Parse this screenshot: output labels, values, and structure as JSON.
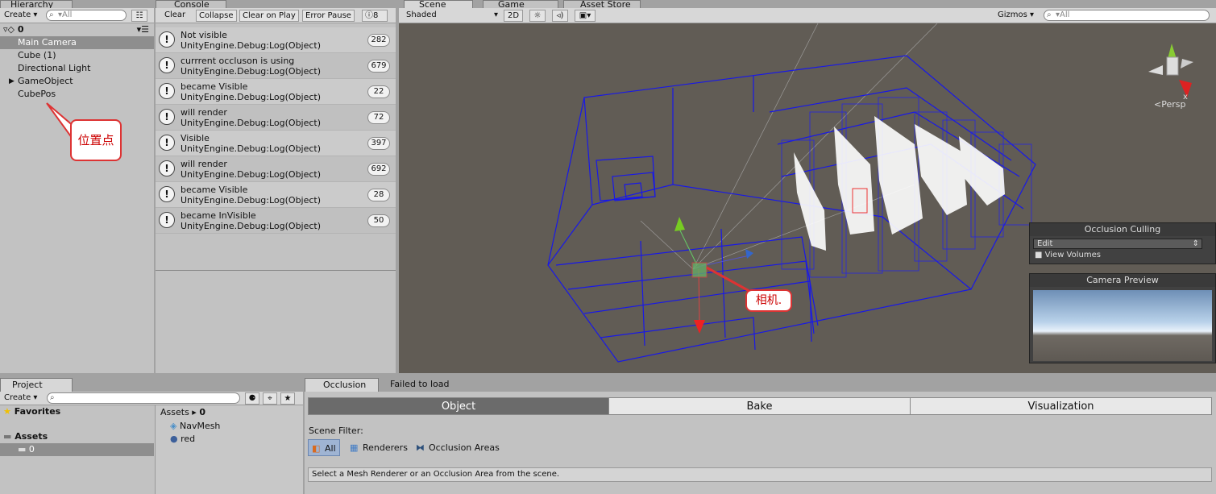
{
  "hierarchy": {
    "tab": "Hierarchy",
    "create": "Create ▾",
    "search_placeholder": "▾All",
    "scene_name": "0",
    "items": [
      "Main Camera",
      "Cube (1)",
      "Directional Light",
      "GameObject",
      "CubePos"
    ],
    "callout": "位置点"
  },
  "console": {
    "tab": "Console",
    "buttons": [
      "Clear",
      "Collapse",
      "Clear on Play",
      "Error Pause"
    ],
    "warn_count": "8",
    "entries": [
      {
        "line1": "Not visible",
        "line2": "UnityEngine.Debug:Log(Object)",
        "count": "282"
      },
      {
        "line1": "currrent occluson is using",
        "line2": "UnityEngine.Debug:Log(Object)",
        "count": "679"
      },
      {
        "line1": "became Visible",
        "line2": "UnityEngine.Debug:Log(Object)",
        "count": "22"
      },
      {
        "line1": "will render",
        "line2": "UnityEngine.Debug:Log(Object)",
        "count": "72"
      },
      {
        "line1": "Visible",
        "line2": "UnityEngine.Debug:Log(Object)",
        "count": "397"
      },
      {
        "line1": "will render",
        "line2": "UnityEngine.Debug:Log(Object)",
        "count": "692"
      },
      {
        "line1": "became Visible",
        "line2": "UnityEngine.Debug:Log(Object)",
        "count": "28"
      },
      {
        "line1": "became InVisible",
        "line2": "UnityEngine.Debug:Log(Object)",
        "count": "50"
      }
    ]
  },
  "scene": {
    "tabs": [
      "Scene",
      "Game",
      "Asset Store"
    ],
    "shading": "Shaded",
    "mode_2d": "2D",
    "gizmos": "Gizmos ▾",
    "search_placeholder": "▾All",
    "persp": "Persp",
    "axis_x": "x",
    "camera_callout": "相机.",
    "occlusion_overlay": {
      "title": "Occlusion Culling",
      "mode": "Edit",
      "checkbox": "View Volumes"
    },
    "camera_preview": {
      "title": "Camera Preview"
    }
  },
  "project": {
    "tab": "Project",
    "create": "Create ▾",
    "favorites": "Favorites",
    "assets": "Assets",
    "folder": "0",
    "breadcrumb_root": "Assets ▸",
    "breadcrumb_leaf": "0",
    "files": [
      "NavMesh",
      "red"
    ]
  },
  "occlusion": {
    "tab": "Occlusion",
    "tab2": "Failed to load",
    "segments": [
      "Object",
      "Bake",
      "Visualization"
    ],
    "filter_label": "Scene Filter:",
    "filters": [
      "All",
      "Renderers",
      "Occlusion Areas"
    ],
    "help": "Select a Mesh Renderer or an Occlusion Area from the scene."
  }
}
